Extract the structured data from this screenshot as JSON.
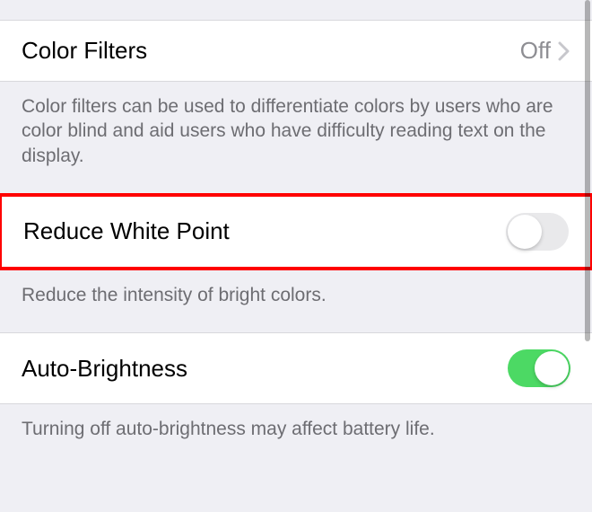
{
  "sections": {
    "color_filters": {
      "label": "Color Filters",
      "value": "Off",
      "footer": "Color filters can be used to differentiate colors by users who are color blind and aid users who have difficulty reading text on the display."
    },
    "reduce_white_point": {
      "label": "Reduce White Point",
      "enabled": false,
      "footer": "Reduce the intensity of bright colors."
    },
    "auto_brightness": {
      "label": "Auto-Brightness",
      "enabled": true,
      "footer": "Turning off auto-brightness may affect battery life."
    }
  }
}
